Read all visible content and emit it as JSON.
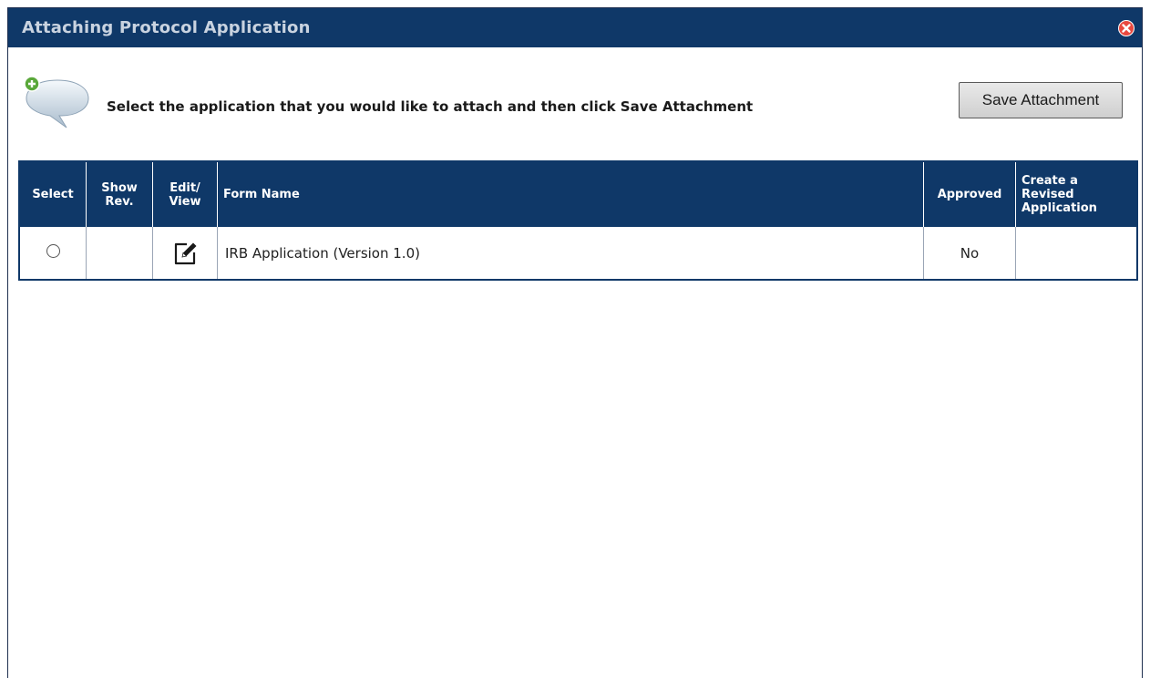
{
  "dialog": {
    "title": "Attaching Protocol Application"
  },
  "instruction": {
    "text": "Select the application that you would like to attach and then click Save Attachment",
    "save_label": "Save Attachment"
  },
  "table": {
    "headers": {
      "select": [
        "Select"
      ],
      "show_rev": [
        "Show",
        "Rev."
      ],
      "edit_view": [
        "Edit/",
        "View"
      ],
      "form_name": [
        "Form Name"
      ],
      "approved": [
        "Approved"
      ],
      "create_revised": [
        "Create a",
        "Revised",
        "Application"
      ]
    },
    "rows": [
      {
        "show_rev": "",
        "form_name": "IRB Application (Version 1.0)",
        "approved": "No",
        "create_revised": ""
      }
    ]
  },
  "colors": {
    "header_bg": "#0f3868",
    "close_icon": "#e8483f",
    "bubble_plus": "#5aa83a"
  },
  "icons": {
    "close": "close-icon",
    "bubble": "speech-bubble-add-icon",
    "edit": "edit-pencil-icon"
  }
}
